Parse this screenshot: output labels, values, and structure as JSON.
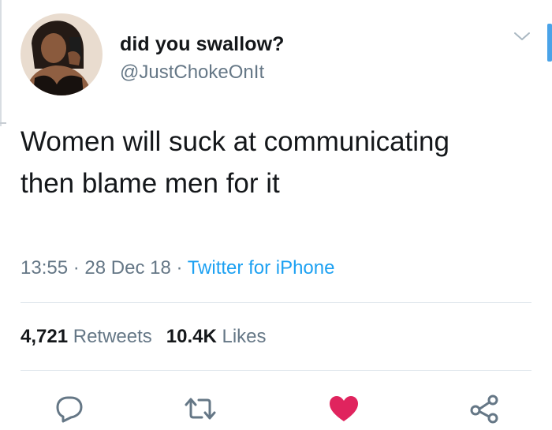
{
  "tweet": {
    "display_name": "did you swallow?",
    "handle": "@JustChokeOnIt",
    "text": "Women will suck at communicating then blame men for it",
    "time": "13:55",
    "date": "28 Dec 18",
    "source": "Twitter for iPhone",
    "separator": "·"
  },
  "stats": {
    "retweets_count": "4,721",
    "retweets_label": "Retweets",
    "likes_count": "10.4K",
    "likes_label": "Likes"
  },
  "actions": {
    "reply_icon": "reply-icon",
    "retweet_icon": "retweet-icon",
    "like_icon": "heart-icon",
    "share_icon": "share-icon",
    "liked": true
  },
  "colors": {
    "accent": "#1da1f2",
    "like": "#e0245e",
    "muted": "#657786",
    "text": "#14171a"
  }
}
